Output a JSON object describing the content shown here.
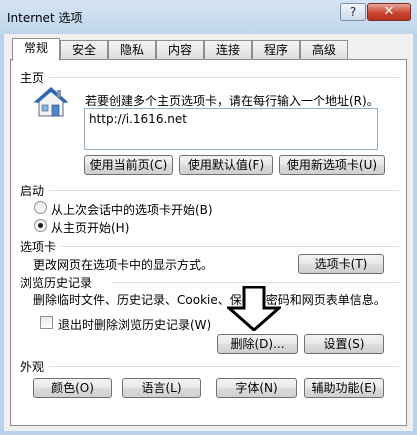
{
  "window": {
    "title": "Internet 选项",
    "help_label": "?",
    "close_label": "✕"
  },
  "tabs": [
    {
      "label": "常规"
    },
    {
      "label": "安全"
    },
    {
      "label": "隐私"
    },
    {
      "label": "内容"
    },
    {
      "label": "连接"
    },
    {
      "label": "程序"
    },
    {
      "label": "高级"
    }
  ],
  "homepage": {
    "section": "主页",
    "description": "若要创建多个主页选项卡，请在每行输入一个地址(R)。",
    "url": "http://i.1616.net",
    "use_current": "使用当前页(C)",
    "use_default": "使用默认值(F)",
    "use_new_tab": "使用新选项卡(U)"
  },
  "startup": {
    "section": "启动",
    "option_last_session": "从上次会话中的选项卡开始(B)",
    "option_home": "从主页开始(H)"
  },
  "tabs_section": {
    "section": "选项卡",
    "description": "更改网页在选项卡中的显示方式。",
    "button": "选项卡(T)"
  },
  "history": {
    "section": "浏览历史记录",
    "description": "删除临时文件、历史记录、Cookie、保存的密码和网页表单信息。",
    "checkbox_label": "退出时删除浏览历史记录(W)",
    "delete_button": "删除(D)...",
    "settings_button": "设置(S)"
  },
  "appearance": {
    "section": "外观",
    "colors": "颜色(O)",
    "languages": "语言(L)",
    "fonts": "字体(N)",
    "accessibility": "辅助功能(E)"
  },
  "colors": {
    "titlebar": "#c8dbee",
    "panel": "#ffffff",
    "sep": "#d5dfe5"
  },
  "icons": {
    "home": "house-icon",
    "arrow": "down-arrow-icon"
  }
}
